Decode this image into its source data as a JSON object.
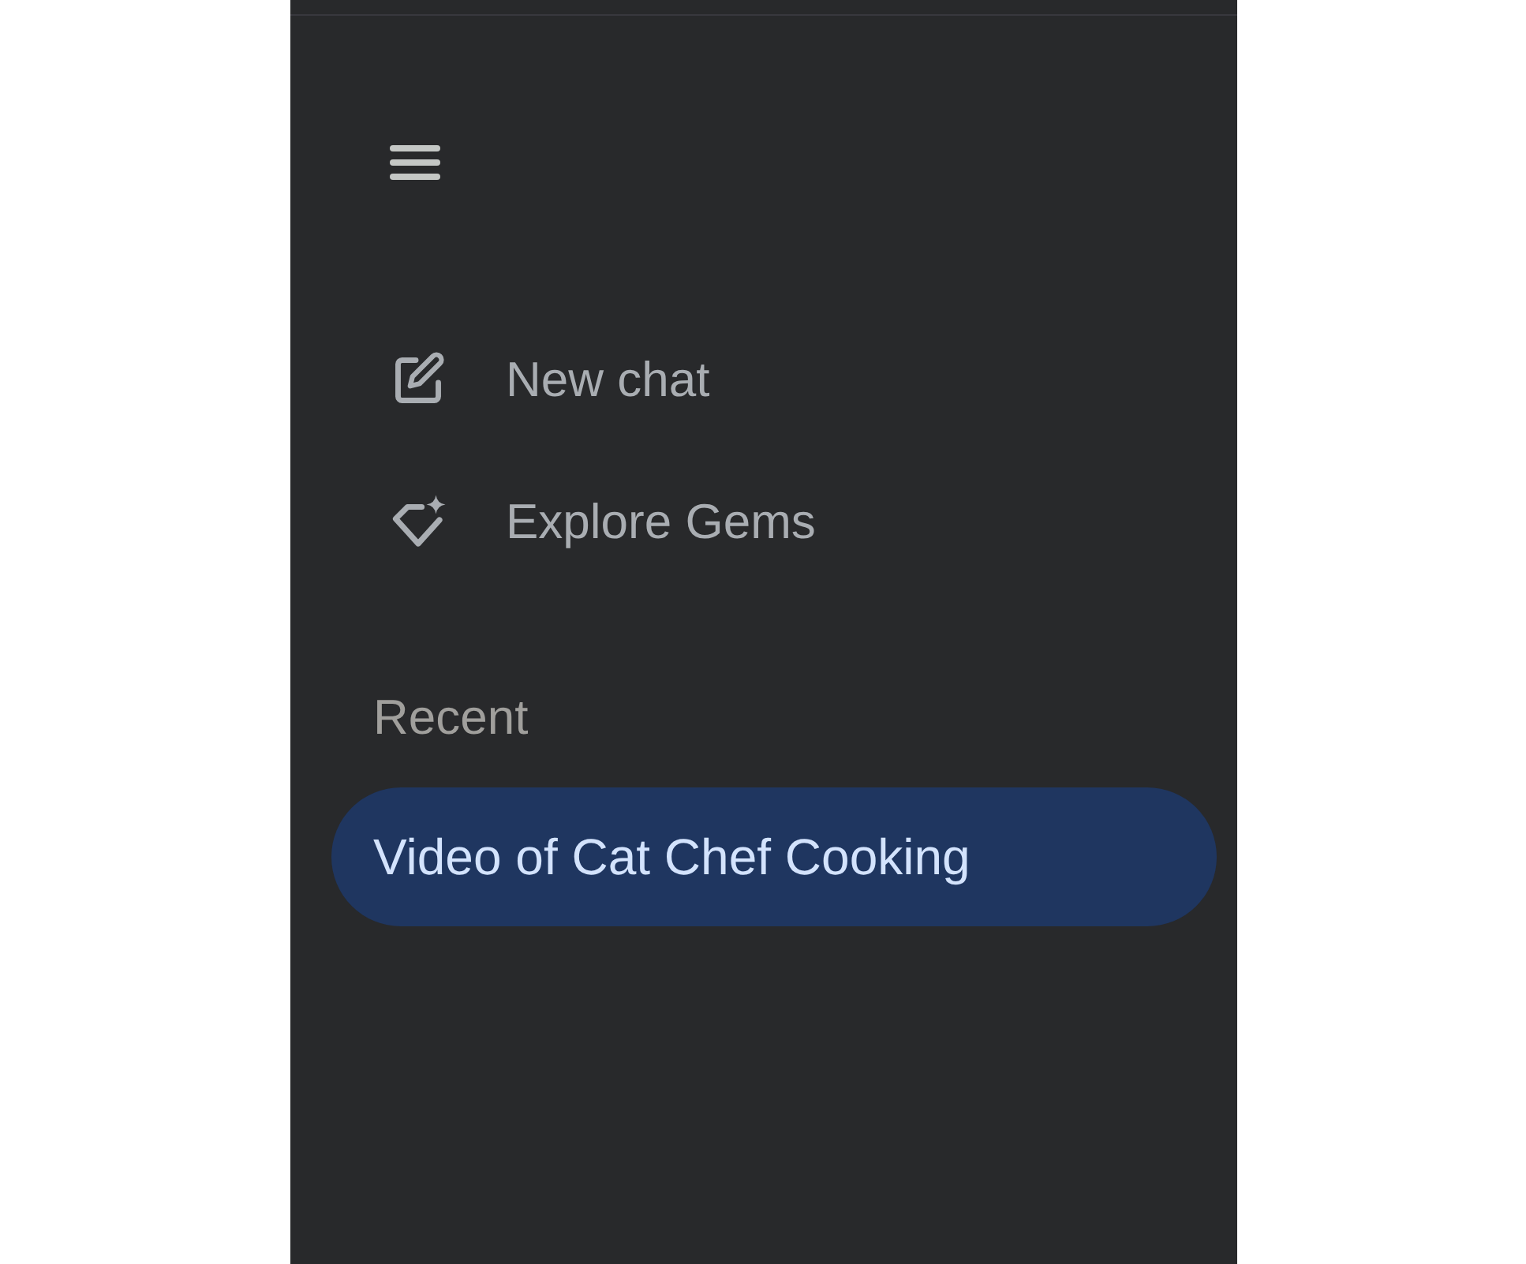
{
  "sidebar": {
    "actions": [
      {
        "kind": "new_chat",
        "label": "New chat"
      },
      {
        "kind": "explore_gems",
        "label": "Explore Gems"
      }
    ],
    "recent": {
      "heading": "Recent",
      "items": [
        {
          "title": "Video of Cat Chef Cooking",
          "selected": true
        }
      ]
    }
  }
}
